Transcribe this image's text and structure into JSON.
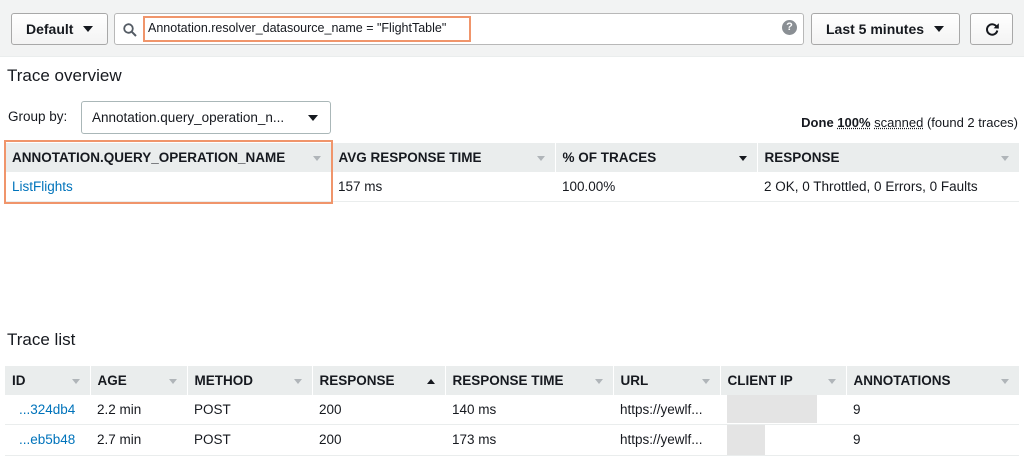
{
  "toolbar": {
    "group_preset": "Default",
    "search_value": "Annotation.resolver_datasource_name = \"FlightTable\"",
    "help_glyph": "?",
    "time_range": "Last 5 minutes",
    "refresh_glyph": "↻"
  },
  "overview": {
    "title": "Trace overview",
    "group_by_label": "Group by:",
    "group_by_value": "Annotation.query_operation_n...",
    "status_done": "Done",
    "status_percent": "100%",
    "status_scanned": "scanned",
    "status_found": "(found 2 traces)",
    "columns": [
      "ANNOTATION.QUERY_OPERATION_NAME",
      "AVG RESPONSE TIME",
      "% OF TRACES",
      "RESPONSE"
    ],
    "rows": [
      {
        "name": "ListFlights",
        "avg": "157 ms",
        "pct": "100.00%",
        "response": "2 OK, 0 Throttled, 0 Errors, 0 Faults"
      }
    ]
  },
  "trace_list": {
    "title": "Trace list",
    "columns": [
      "ID",
      "AGE",
      "METHOD",
      "RESPONSE",
      "RESPONSE TIME",
      "URL",
      "CLIENT IP",
      "ANNOTATIONS"
    ],
    "rows": [
      {
        "id": "...324db4",
        "age": "2.2 min",
        "method": "POST",
        "response": "200",
        "time": "140 ms",
        "url": "https://yewlf...",
        "client_ip": "",
        "annotations": "9"
      },
      {
        "id": "...eb5b48",
        "age": "2.7 min",
        "method": "POST",
        "response": "200",
        "time": "173 ms",
        "url": "https://yewlf...",
        "client_ip": "",
        "annotations": "9"
      }
    ]
  },
  "colors": {
    "accent_link": "#0073bb",
    "highlight": "#f0956b",
    "header_bg": "#eaeded"
  },
  "icons": [
    "search-icon",
    "help-icon",
    "refresh-icon",
    "chevron-down-icon",
    "sort-icon"
  ]
}
